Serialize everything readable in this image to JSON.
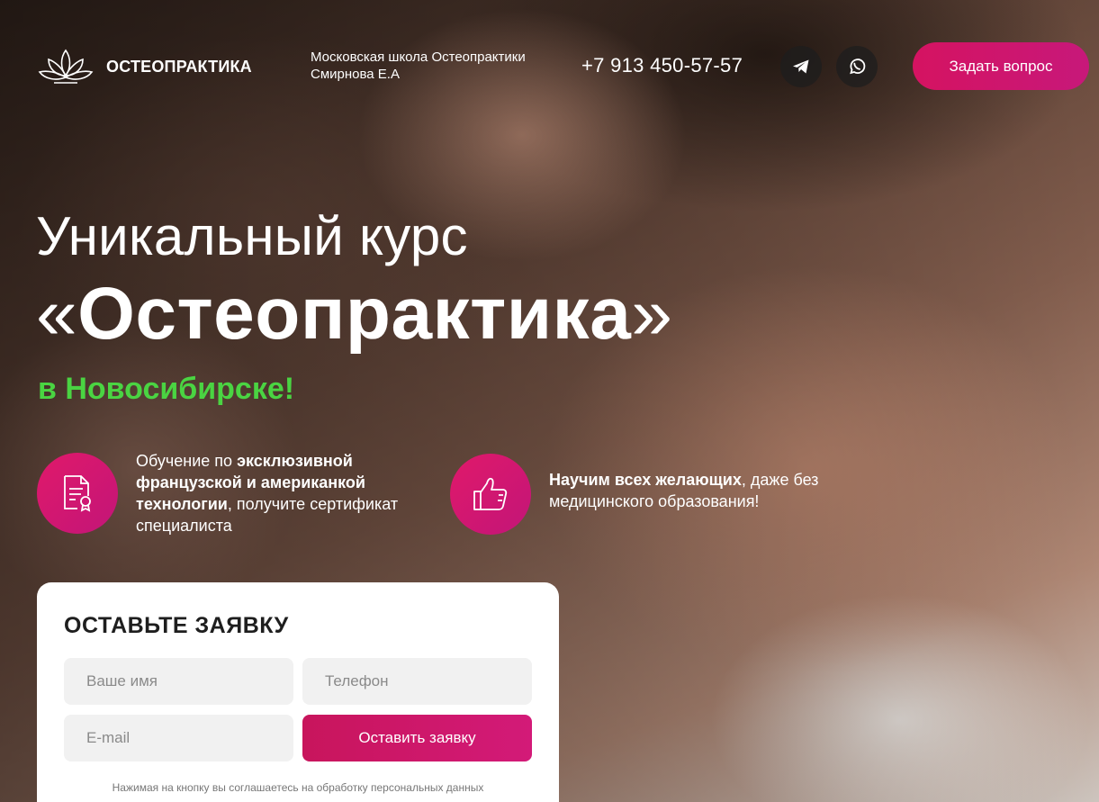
{
  "header": {
    "logo_text": "ОСТЕОПРАКТИКА",
    "school_line1": "Московская школа Остеопрактики",
    "school_line2": "Смирнова Е.А",
    "phone": "+7 913 450-57-57",
    "social": [
      {
        "name": "telegram",
        "icon": "telegram-icon"
      },
      {
        "name": "whatsapp",
        "icon": "whatsapp-icon"
      }
    ],
    "ask_button": "Задать вопрос"
  },
  "hero": {
    "line1": "Уникальный курс",
    "open_quote": "«",
    "course_name": "Остеопрактика",
    "close_quote": "»",
    "city": "в Новосибирске!"
  },
  "features": [
    {
      "icon": "certificate-icon",
      "text_pre": "Обучение по ",
      "text_bold": "эксклюзивной французской и американкой технологии",
      "text_post": ", получите сертификат специалиста"
    },
    {
      "icon": "thumbs-up-icon",
      "text_bold": "Научим всех желающих",
      "text_post": ", даже без медицинского образования!"
    }
  ],
  "form": {
    "title": "ОСТАВЬТЕ ЗАЯВКУ",
    "name_placeholder": "Ваше имя",
    "phone_placeholder": "Телефон",
    "email_placeholder": "E-mail",
    "submit_label": "Оставить заявку",
    "consent": "Нажимая на кнопку вы соглашаетесь на обработку персональных данных"
  },
  "colors": {
    "accent": "#d51361",
    "city_green": "#4ad442",
    "field_bg": "#f1f1f1"
  }
}
